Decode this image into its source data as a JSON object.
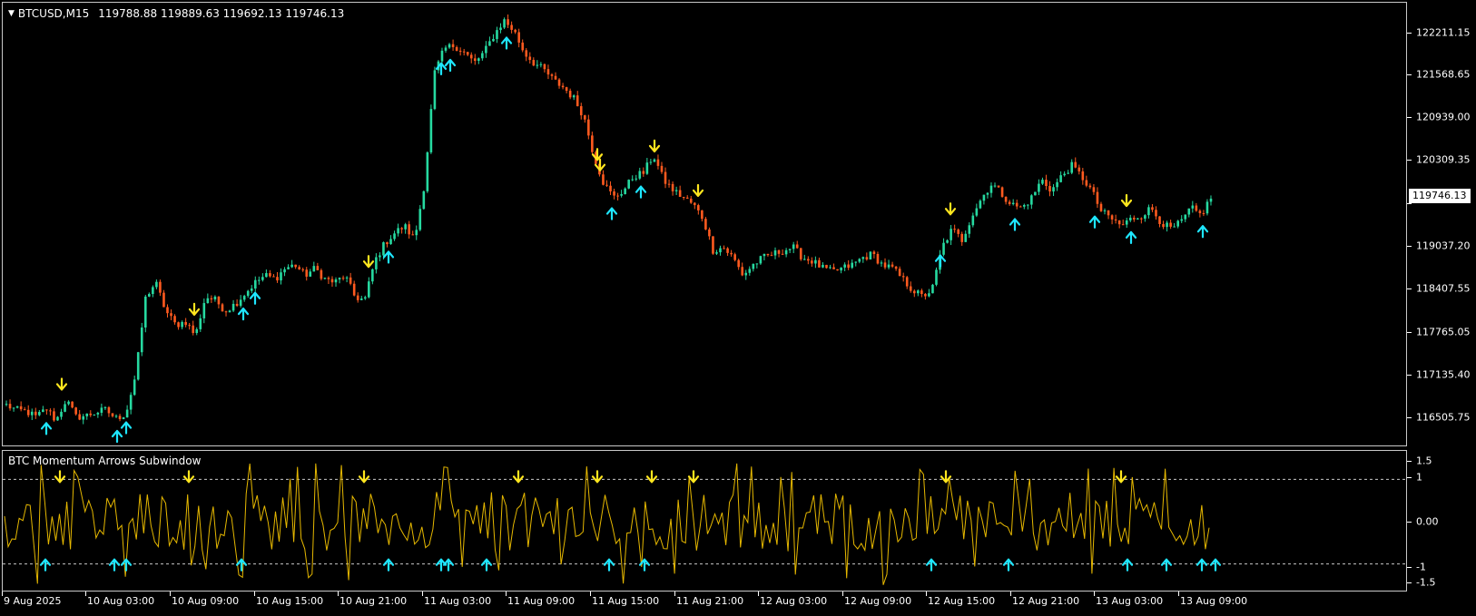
{
  "header": {
    "symbol": "BTCUSD,M15",
    "ohlc": "119788.88 119889.63 119692.13 119746.13"
  },
  "price_axis": {
    "labels": [
      "122211.15",
      "121568.65",
      "120939.00",
      "120309.35",
      "119746.13",
      "119037.20",
      "118407.55",
      "117765.05",
      "117135.40",
      "116505.75"
    ],
    "current_price": "119746.13"
  },
  "subwindow": {
    "title": "BTC Momentum Arrows Subwindow",
    "axis_labels": [
      "1.5",
      "1",
      "0.00",
      "-1",
      "-1.5"
    ]
  },
  "time_axis": {
    "labels": [
      "9 Aug 2025",
      "10 Aug 03:00",
      "10 Aug 09:00",
      "10 Aug 15:00",
      "10 Aug 21:00",
      "11 Aug 03:00",
      "11 Aug 09:00",
      "11 Aug 15:00",
      "11 Aug 21:00",
      "12 Aug 03:00",
      "12 Aug 09:00",
      "12 Aug 15:00",
      "12 Aug 21:00",
      "13 Aug 03:00",
      "13 Aug 09:00"
    ]
  },
  "colors": {
    "background": "#000000",
    "bull": "#26d9a0",
    "bear": "#ff5a1f",
    "buy_arrow": "#1ee6ff",
    "sell_arrow": "#ffe61e",
    "oscillator": "#e6b800",
    "level_line": "#c8c8c8"
  },
  "chart_data": [
    {
      "type": "candlestick",
      "title": "BTCUSD,M15",
      "ylim": [
        116300,
        122550
      ],
      "y_ticks": [
        122211.15,
        121568.65,
        120939.0,
        120309.35,
        119746.13,
        119037.2,
        118407.55,
        117765.05,
        117135.4,
        116505.75
      ],
      "x_labels": [
        "9 Aug 2025",
        "10 Aug 03:00",
        "10 Aug 09:00",
        "10 Aug 15:00",
        "10 Aug 21:00",
        "11 Aug 03:00",
        "11 Aug 09:00",
        "11 Aug 15:00",
        "11 Aug 21:00",
        "12 Aug 03:00",
        "12 Aug 09:00",
        "12 Aug 15:00",
        "12 Aug 21:00",
        "13 Aug 03:00",
        "13 Aug 09:00"
      ],
      "close_path": [
        116870,
        116800,
        116780,
        116700,
        116820,
        116650,
        116950,
        116700,
        116720,
        116770,
        116800,
        116680,
        116750,
        117300,
        118400,
        118600,
        118200,
        118000,
        118050,
        117850,
        118400,
        118350,
        118200,
        118300,
        118450,
        118600,
        118700,
        118650,
        118800,
        118850,
        118700,
        118800,
        118650,
        118600,
        118700,
        118400,
        118350,
        118900,
        119150,
        119300,
        119400,
        119200,
        120000,
        121550,
        121900,
        121950,
        121850,
        121700,
        121850,
        122100,
        122300,
        122150,
        121850,
        121700,
        121600,
        121450,
        121350,
        121200,
        120950,
        120400,
        120000,
        119800,
        119900,
        120100,
        120150,
        120400,
        120050,
        119900,
        119800,
        119700,
        119500,
        119050,
        119100,
        118950,
        118700,
        118850,
        118950,
        119000,
        119050,
        119100,
        118950,
        118900,
        118800,
        118750,
        118800,
        118850,
        118950,
        119000,
        118850,
        118800,
        118650,
        118500,
        118400,
        118500,
        119100,
        119350,
        119200,
        119550,
        119800,
        120000,
        119850,
        119700,
        119650,
        119800,
        120050,
        119900,
        120100,
        120250,
        120100,
        119900,
        119600,
        119500,
        119400,
        119500,
        119550,
        119650,
        119450,
        119350,
        119450,
        119650,
        119550,
        119800
      ],
      "buy_signal_x": [
        "9 Aug 2025",
        "10 Aug 03:00",
        "10 Aug 03:00",
        "10 Aug 09:00",
        "10 Aug 15:00",
        "10 Aug 21:00",
        "11 Aug 03:00",
        "11 Aug 03:00",
        "11 Aug 09:00",
        "11 Aug 15:00",
        "11 Aug 15:00",
        "12 Aug 15:00",
        "12 Aug 21:00",
        "13 Aug 03:00",
        "13 Aug 03:00",
        "13 Aug 09:00"
      ],
      "sell_signal_x": [
        "9 Aug 2025",
        "10 Aug 09:00",
        "10 Aug 21:00",
        "11 Aug 09:00",
        "11 Aug 15:00",
        "11 Aug 15:00",
        "11 Aug 21:00",
        "12 Aug 15:00",
        "13 Aug 03:00"
      ]
    },
    {
      "type": "line",
      "title": "BTC Momentum Arrows Subwindow",
      "ylim": [
        -1.5,
        1.5
      ],
      "y_ticks": [
        1.5,
        1,
        0,
        -1,
        -1.5
      ],
      "levels": [
        1,
        -1
      ],
      "spikes_up_count": 11,
      "spikes_down_count": 17
    }
  ]
}
